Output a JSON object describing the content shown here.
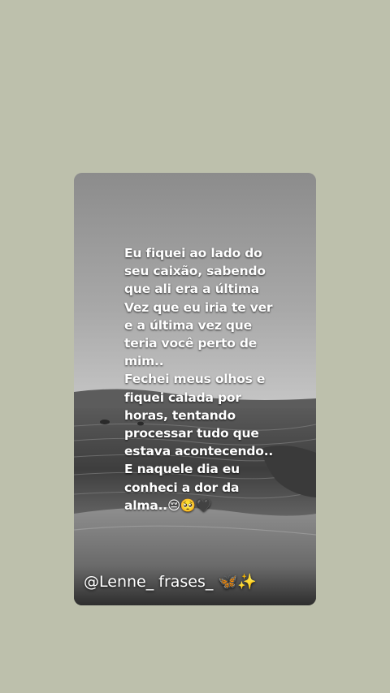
{
  "quote": {
    "lines": [
      "Eu fiquei ao lado do",
      "seu caixão, sabendo",
      "que ali era a última",
      "Vez que eu iria te ver",
      "e a última vez que",
      "teria você perto de",
      "mim..",
      "Fechei meus olhos e",
      "fiquei calada por",
      "horas, tentando",
      "processar tudo que",
      "estava acontecendo..",
      "E naquele dia eu",
      "conheci a dor da",
      "alma.."
    ],
    "emojis": "😔🥺🖤"
  },
  "watermark": {
    "handle": "@Lenne_ frases_",
    "emojis": "🦋✨"
  },
  "colors": {
    "page_background": "#bdc0ac",
    "text": "#ffffff"
  }
}
